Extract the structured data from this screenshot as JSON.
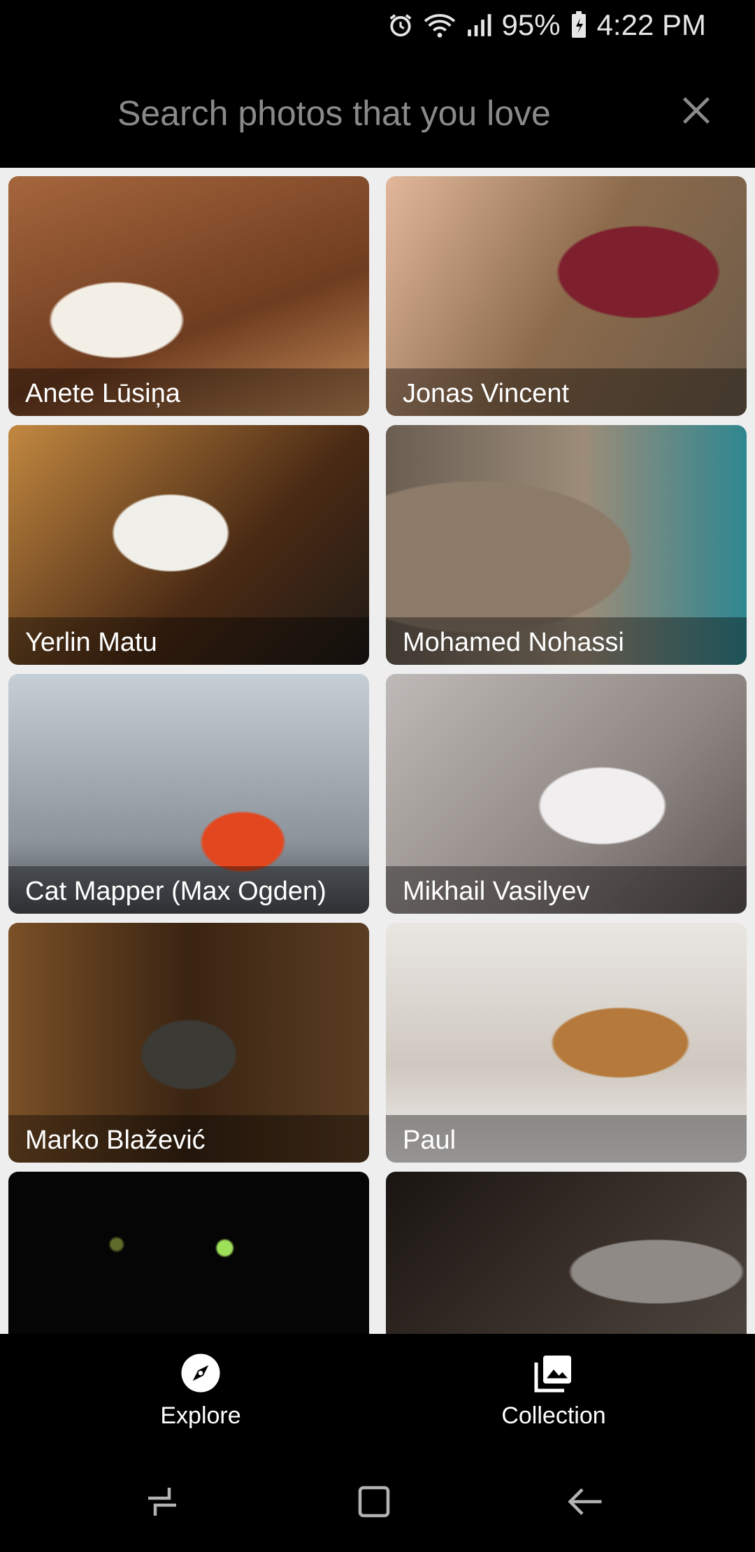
{
  "status_bar": {
    "battery": "95%",
    "time": "4:22 PM",
    "icons": [
      "alarm-icon",
      "wifi-icon",
      "signal-icon",
      "battery-charging-icon"
    ]
  },
  "search": {
    "placeholder": "Search photos that you love",
    "value": "",
    "close_icon": "close-icon"
  },
  "photos": [
    {
      "author": "Anete Lūsiņa"
    },
    {
      "author": "Jonas Vincent"
    },
    {
      "author": "Yerlin Matu"
    },
    {
      "author": "Mohamed Nohassi"
    },
    {
      "author": "Cat Mapper (Max Ogden)"
    },
    {
      "author": "Mikhail Vasilyev"
    },
    {
      "author": "Marko Blažević"
    },
    {
      "author": "Paul"
    },
    {
      "author": ""
    },
    {
      "author": ""
    }
  ],
  "bottom_nav": {
    "items": [
      {
        "label": "Explore",
        "icon": "compass-icon"
      },
      {
        "label": "Collection",
        "icon": "photo-library-icon"
      }
    ]
  },
  "system_nav": {
    "icons": [
      "recents-icon",
      "home-icon",
      "back-icon"
    ]
  }
}
